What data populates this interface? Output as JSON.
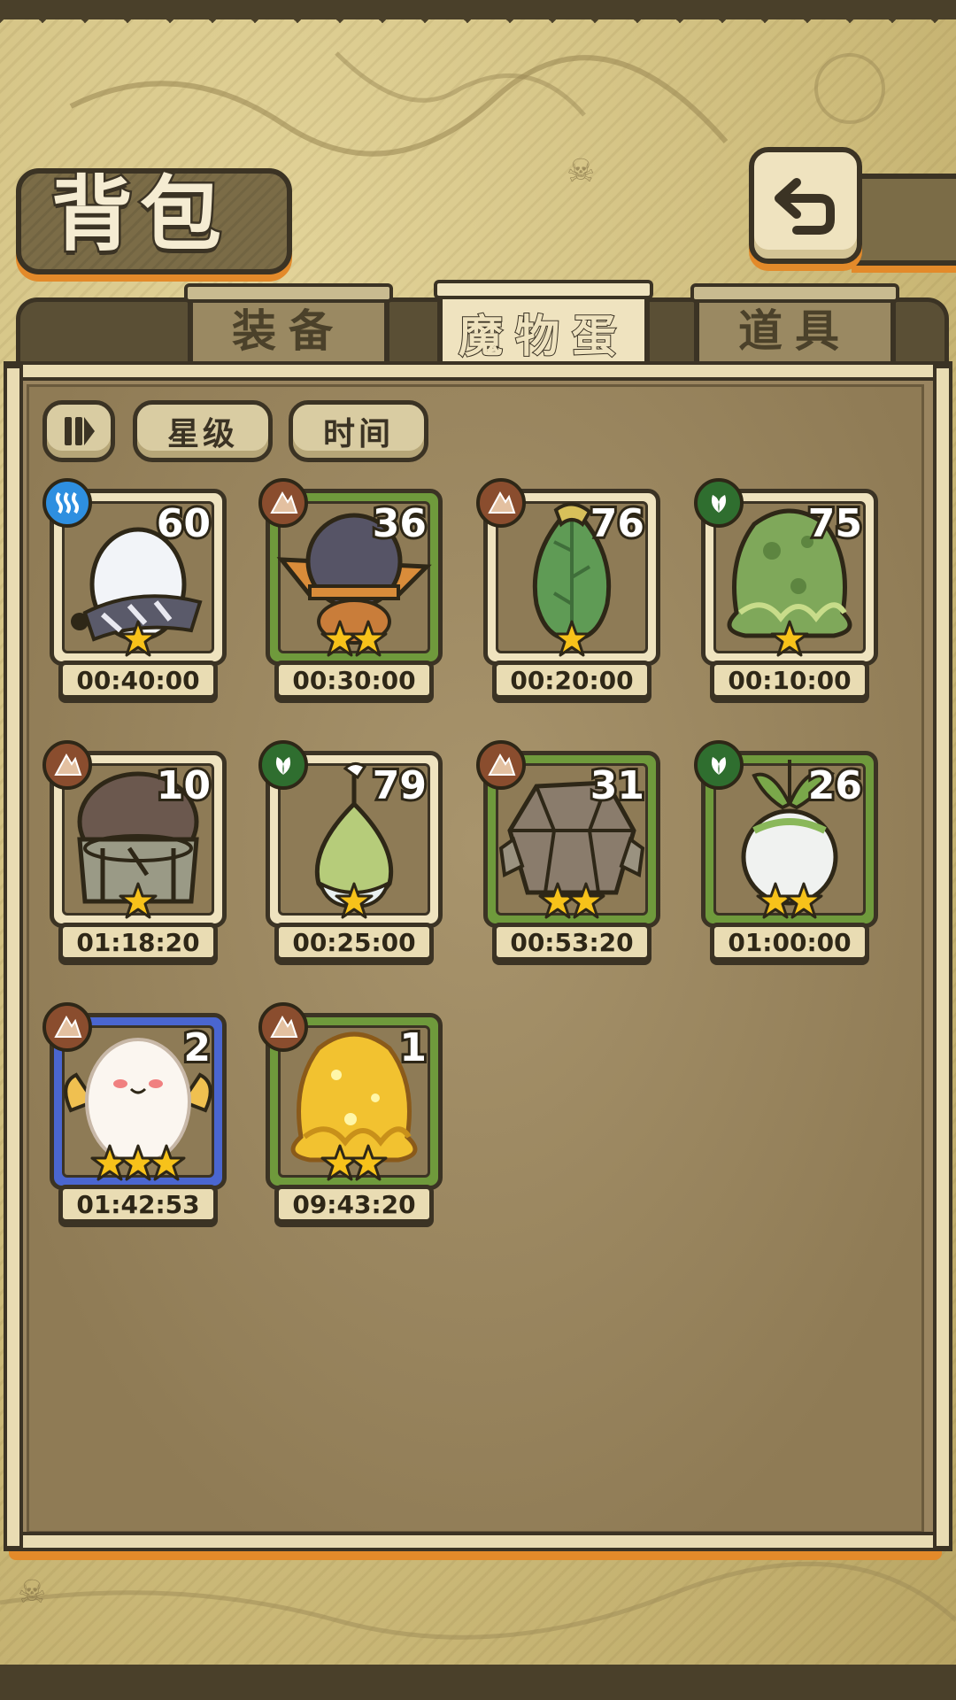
{
  "header": {
    "title": "背包"
  },
  "tabs": [
    {
      "label": "装备",
      "active": false
    },
    {
      "label": "魔物蛋",
      "active": true
    },
    {
      "label": "道具",
      "active": false
    }
  ],
  "sort": {
    "star_label": "星级",
    "time_label": "时间"
  },
  "eggs": [
    {
      "count": "60",
      "timer": "00:40:00",
      "element": "water",
      "stars": 1,
      "frame": "plain",
      "egg": "white-striped-egg"
    },
    {
      "count": "36",
      "timer": "00:30:00",
      "element": "earth",
      "stars": 2,
      "frame": "green",
      "egg": "hat-egg"
    },
    {
      "count": "76",
      "timer": "00:20:00",
      "element": "earth",
      "stars": 1,
      "frame": "plain",
      "egg": "leaf-bud-egg"
    },
    {
      "count": "75",
      "timer": "00:10:00",
      "element": "wood",
      "stars": 1,
      "frame": "plain",
      "egg": "slime-egg"
    },
    {
      "count": "10",
      "timer": "01:18:20",
      "element": "earth",
      "stars": 1,
      "frame": "plain",
      "egg": "helmet-egg"
    },
    {
      "count": "79",
      "timer": "00:25:00",
      "element": "wood",
      "stars": 1,
      "frame": "plain",
      "egg": "seed-egg"
    },
    {
      "count": "31",
      "timer": "00:53:20",
      "element": "earth",
      "stars": 2,
      "frame": "green",
      "egg": "rock-egg"
    },
    {
      "count": "26",
      "timer": "01:00:00",
      "element": "wood",
      "stars": 2,
      "frame": "green",
      "egg": "turnip-egg"
    },
    {
      "count": "2",
      "timer": "01:42:53",
      "element": "earth",
      "stars": 3,
      "frame": "blue",
      "egg": "fluffy-egg"
    },
    {
      "count": "1",
      "timer": "09:43:20",
      "element": "earth",
      "stars": 2,
      "frame": "green",
      "egg": "gold-slime-egg"
    }
  ],
  "colors": {
    "accent_orange": "#e38a2a",
    "outline": "#3b3324",
    "frame_green": "#6f9a3c",
    "frame_blue": "#4a66d0"
  }
}
